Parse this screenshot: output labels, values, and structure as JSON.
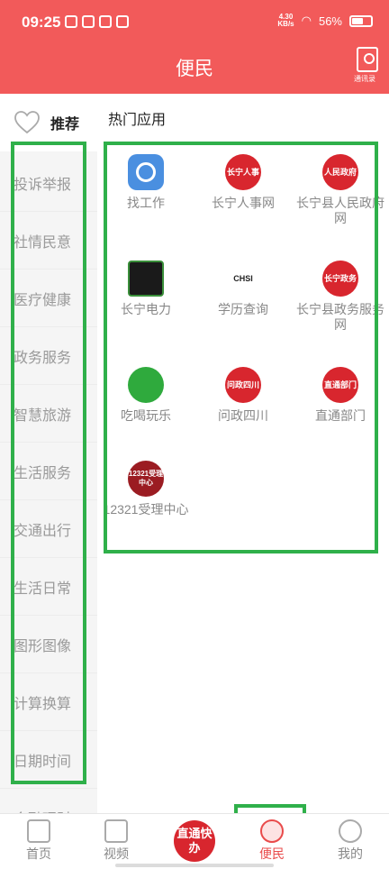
{
  "status_bar": {
    "time": "09:25",
    "network_speed_value": "4.30",
    "network_speed_unit": "KB/s",
    "battery": "56%"
  },
  "header": {
    "title": "便民",
    "contacts_label": "通讯录"
  },
  "sidebar": {
    "recommend_label": "推荐",
    "items": [
      "投诉举报",
      "社情民意",
      "医疗健康",
      "政务服务",
      "智慧旅游",
      "生活服务",
      "交通出行",
      "生活日常",
      "图形图像",
      "计算换算",
      "日期时间",
      "金融理财"
    ]
  },
  "main": {
    "section_title": "热门应用",
    "apps": [
      {
        "name": "找工作",
        "icon": "job-search-icon",
        "icon_text": ""
      },
      {
        "name": "长宁人事网",
        "icon": "changning-hr-seal-icon",
        "icon_text": "长宁人事"
      },
      {
        "name": "长宁县人民政府网",
        "icon": "county-government-seal-icon",
        "icon_text": "人民政府"
      },
      {
        "name": "长宁电力",
        "icon": "power-company-icon",
        "icon_text": ""
      },
      {
        "name": "学历查询",
        "icon": "chsi-logo-icon",
        "icon_text": "CHSI"
      },
      {
        "name": "长宁县政务服务网",
        "icon": "gov-service-seal-icon",
        "icon_text": "长宁政务"
      },
      {
        "name": "吃喝玩乐",
        "icon": "leisure-icon",
        "icon_text": ""
      },
      {
        "name": "问政四川",
        "icon": "wenzheng-sichuan-seal-icon",
        "icon_text": "问政四川"
      },
      {
        "name": "直通部门",
        "icon": "direct-department-seal-icon",
        "icon_text": "直通部门"
      },
      {
        "name": "12321受理中心",
        "icon": "report-center-icon",
        "icon_text": "12321受理中心"
      }
    ]
  },
  "bottom_nav": {
    "items": [
      {
        "label": "首页",
        "icon": "home-icon"
      },
      {
        "label": "视频",
        "icon": "video-icon"
      },
      {
        "label": "便民",
        "icon": "heart-icon",
        "active": true
      },
      {
        "label": "我的",
        "icon": "profile-icon"
      }
    ],
    "center_label": "直通快办"
  },
  "colors": {
    "header": "#f25a5a",
    "accent": "#e94b4b",
    "highlight_box": "#2fb04a",
    "seal_red": "#d8262e"
  }
}
